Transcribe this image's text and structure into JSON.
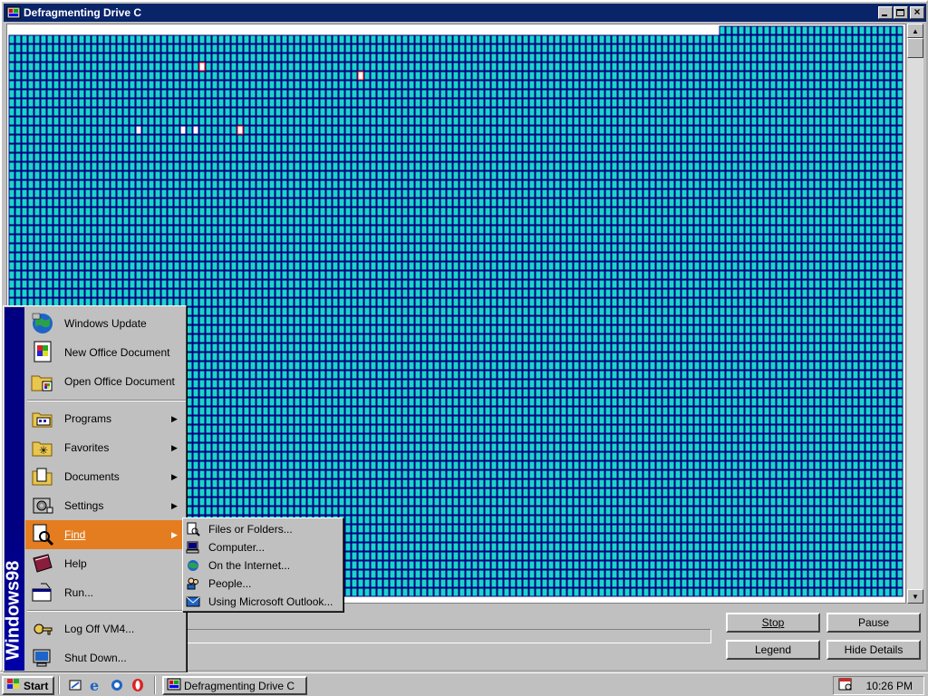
{
  "window": {
    "title": "Defragmenting Drive C",
    "minimize_label": "_",
    "maximize_label": "□",
    "close_label": "×"
  },
  "diskmap": {
    "block_color": "#1ad5c8",
    "border_color": "#000080",
    "unused_color": "#ffffff"
  },
  "progress": {
    "percent": 0
  },
  "buttons": {
    "stop": "Stop",
    "pause": "Pause",
    "legend": "Legend",
    "hide_details": "Hide Details"
  },
  "start_menu": {
    "banner": "Windows98",
    "items": [
      {
        "label": "Windows Update",
        "icon": "globe-icon",
        "has_submenu": false
      },
      {
        "label": "New Office Document",
        "icon": "office-doc-icon",
        "has_submenu": false
      },
      {
        "label": "Open Office Document",
        "icon": "open-folder-icon",
        "has_submenu": false
      },
      {
        "label": "Programs",
        "icon": "programs-icon",
        "has_submenu": true
      },
      {
        "label": "Favorites",
        "icon": "favorites-icon",
        "has_submenu": true
      },
      {
        "label": "Documents",
        "icon": "documents-icon",
        "has_submenu": true
      },
      {
        "label": "Settings",
        "icon": "settings-icon",
        "has_submenu": true
      },
      {
        "label": "Find",
        "icon": "find-icon",
        "has_submenu": true,
        "selected": true
      },
      {
        "label": "Help",
        "icon": "help-icon",
        "has_submenu": false
      },
      {
        "label": "Run...",
        "icon": "run-icon",
        "has_submenu": false
      },
      {
        "label": "Log Off VM4...",
        "icon": "logoff-icon",
        "has_submenu": false
      },
      {
        "label": "Shut Down...",
        "icon": "shutdown-icon",
        "has_submenu": false
      }
    ],
    "highlight_color": "#e47d20"
  },
  "find_submenu": {
    "items": [
      {
        "label": "Files or Folders...",
        "icon": "files-search-icon"
      },
      {
        "label": "Computer...",
        "icon": "computer-icon"
      },
      {
        "label": "On the Internet...",
        "icon": "internet-search-icon"
      },
      {
        "label": "People...",
        "icon": "people-icon"
      },
      {
        "label": "Using Microsoft Outlook...",
        "icon": "outlook-icon"
      }
    ]
  },
  "taskbar": {
    "start_label": "Start",
    "task_label": "Defragmenting Drive C",
    "clock": "10:26 PM",
    "quick_launch": [
      "show-desktop-icon",
      "ie-icon",
      "channels-icon",
      "opera-icon"
    ]
  }
}
